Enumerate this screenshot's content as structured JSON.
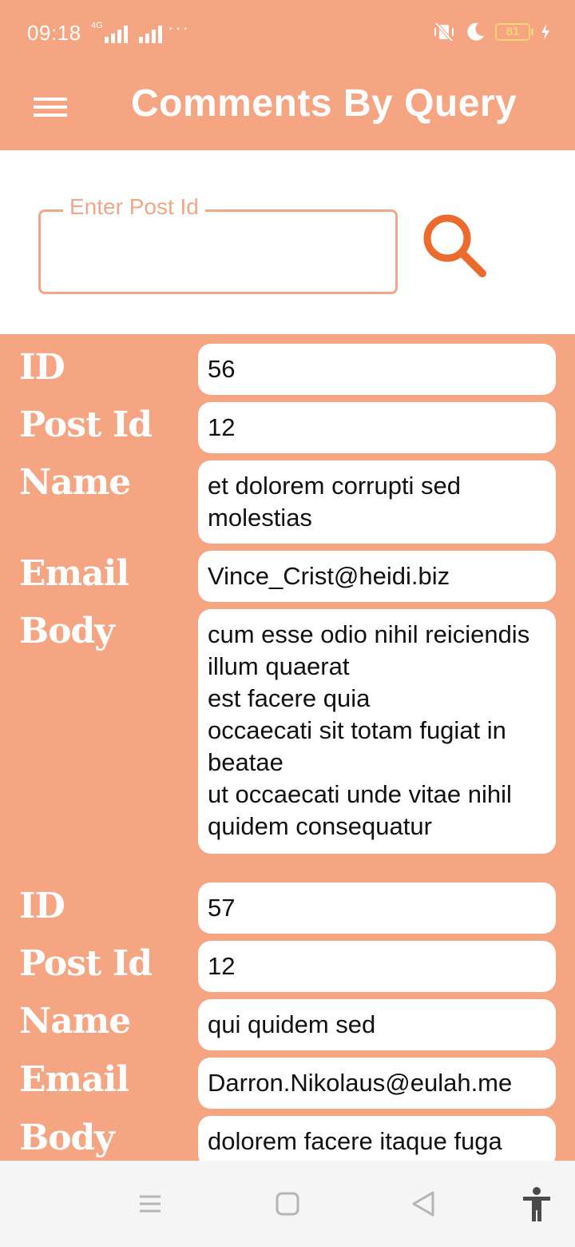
{
  "status_bar": {
    "time": "09:18",
    "network_type": "4G",
    "overflow_dots": "···",
    "battery_level": "81",
    "icons": [
      "signal-icon",
      "vibrate-off-icon",
      "moon-icon",
      "battery-icon",
      "charging-icon"
    ]
  },
  "app_bar": {
    "title": "Comments By Query",
    "menu_icon": "menu-icon"
  },
  "search": {
    "label": "Enter Post Id",
    "value": "",
    "icon": "search-icon"
  },
  "field_labels": {
    "id": "ID",
    "post_id": "Post Id",
    "name": "Name",
    "email": "Email",
    "body": "Body"
  },
  "comments": [
    {
      "id": "56",
      "post_id": "12",
      "name": "et dolorem corrupti sed molestias",
      "email": "Vince_Crist@heidi.biz",
      "body": "cum esse odio nihil reiciendis illum quaerat\nest facere quia\noccaecati sit totam fugiat in beatae\nut occaecati unde vitae nihil quidem consequatur"
    },
    {
      "id": "57",
      "post_id": "12",
      "name": "qui quidem sed",
      "email": "Darron.Nikolaus@eulah.me",
      "body": "dolorem facere itaque fuga"
    }
  ],
  "colors": {
    "accent": "#f5a582",
    "search_icon": "#ec6a2c",
    "outline": "#f1a785"
  },
  "nav_bar": {
    "icons": [
      "recents-icon",
      "home-icon",
      "back-icon",
      "accessibility-icon"
    ]
  }
}
